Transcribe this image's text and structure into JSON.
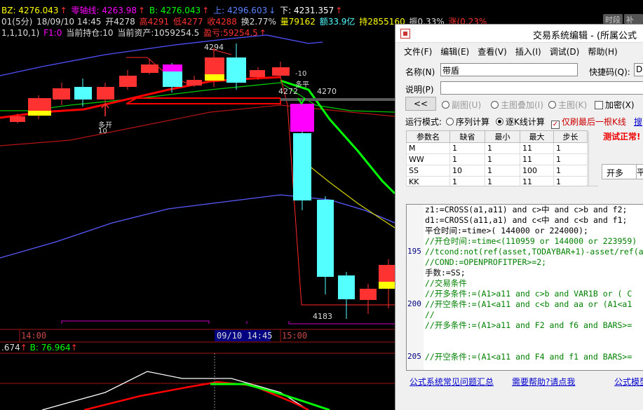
{
  "quote_line": {
    "bz": "BZ: 4276.043",
    "zero_axis": "零轴线: 4263.98",
    "b": "B: 4276.043",
    "up": "上: 4296.603",
    "down": "下: 4231.357"
  },
  "bar_line": {
    "prefix": "01(5分)",
    "date": "18/09/10 14:45",
    "open": "开4278",
    "high": "高4291",
    "low": "低4277",
    "close": "收4288",
    "turnover": "换2.77%",
    "volume": "量79162",
    "amount": "额33.9亿",
    "position": "持2855160",
    "amplitude": "振0.33%",
    "change": "涨(0.23%"
  },
  "top_buttons": {
    "time_share": "时段",
    "replenish": "补数"
  },
  "indicator_line": {
    "params": "1,1,10,1)",
    "f1": "F1:0",
    "holding": "当前持仓:10",
    "assets": "当前资产:1059254.5",
    "loss": "盈亏:59254.5"
  },
  "chart_labels": {
    "high_peak": "4294",
    "marker_4272": "4272",
    "marker_4270": "4270",
    "low_trough": "4183",
    "signal_buy_open": "多开",
    "signal_buy_qty": "10",
    "signal_sell_qty": "-10",
    "signal_sell_open": "多平"
  },
  "time_axis": {
    "t1": "14:00",
    "t2": "09/10 14:45",
    "t3": "15:00"
  },
  "sub_indicator": {
    "value_a": ".674",
    "value_b": "B: 76.964"
  },
  "colors": {
    "up_candle": "#ff3232",
    "down_candle": "#54ffff",
    "background": "#000000",
    "ma_red": "#ff0000",
    "ma_green": "#00ff00",
    "ma_blue": "#5050ff",
    "ma_yellow": "#ffff00",
    "magenta": "#ff00ff"
  },
  "dialog": {
    "title": "交易系统编辑 - (所属公式",
    "menu": [
      "文件(F)",
      "编辑(E)",
      "查看(V)",
      "插入(I)",
      "调试(D)",
      "帮助(H)"
    ],
    "name_label": "名称(N)",
    "name_value": "带盾",
    "hotkey_label": "快捷码(Q):",
    "hotkey_value": "DI",
    "desc_label": "说明(P)",
    "desc_value": "",
    "toolbar": {
      "back": "<<",
      "opt_subchart": "副图(U)",
      "opt_overlay": "主图叠加(I)",
      "opt_main": "主图(K)",
      "encrypt": "加密(X)"
    },
    "run_mode_label": "运行模式:",
    "run_seq": "序列计算",
    "run_bar": "逐K线计算",
    "only_last": "仅刷最后一根K线",
    "extra_link": "搜",
    "test_status": "测试正常!",
    "params_table": {
      "headers": [
        "参数名",
        "缺省",
        "最小",
        "最大",
        "步长"
      ],
      "rows": [
        [
          "M",
          "1",
          "1",
          "11",
          "1"
        ],
        [
          "WW",
          "1",
          "1",
          "11",
          "1"
        ],
        [
          "SS",
          "10",
          "1",
          "100",
          "1"
        ],
        [
          "KK",
          "1",
          "1",
          "11",
          "1"
        ]
      ]
    },
    "tab_open": "开多",
    "tab_second": "平",
    "code_lines": [
      {
        "num": "",
        "text": "z1:=CROSS(a1,a11) and c>中 and c>b and f2;"
      },
      {
        "num": "",
        "text": "d1:=CROSS(a11,a1) and c<中 and c<b and f1;"
      },
      {
        "num": "",
        "text": "平仓时间:=time>( 144000 or 224000);"
      },
      {
        "num": "",
        "text": "//开仓时间:=time<(110959 or 144000 or 223959)"
      },
      {
        "num": "195",
        "text": "//tcond:not(ref(asset,TODAYBAR+1)-asset/ref(a"
      },
      {
        "num": "",
        "text": "//COND:=OPENPROFITPER>=2;"
      },
      {
        "num": "",
        "text": "手数:=SS;"
      },
      {
        "num": "",
        "text": "//交易条件"
      },
      {
        "num": "",
        "text": "//开多条件:=(A1>a11 and c>b and VAR1B  or ( C"
      },
      {
        "num": "200",
        "text": "//开空条件:=(A1<a11 and c<b and aa  or (A1<a1"
      },
      {
        "num": "",
        "text": "//"
      },
      {
        "num": "",
        "text": "//开多条件:=(A1>a11  and F2 and f6 and BARS>="
      },
      {
        "num": "",
        "text": ""
      },
      {
        "num": "",
        "text": ""
      },
      {
        "num": "205",
        "text": "//开空条件:=(A1<a11  and F4 and f1 and BARS>="
      }
    ],
    "links": {
      "faq": "公式系统常见问题汇总",
      "help": "需要帮助?请点我",
      "formula": "公式模型"
    }
  }
}
